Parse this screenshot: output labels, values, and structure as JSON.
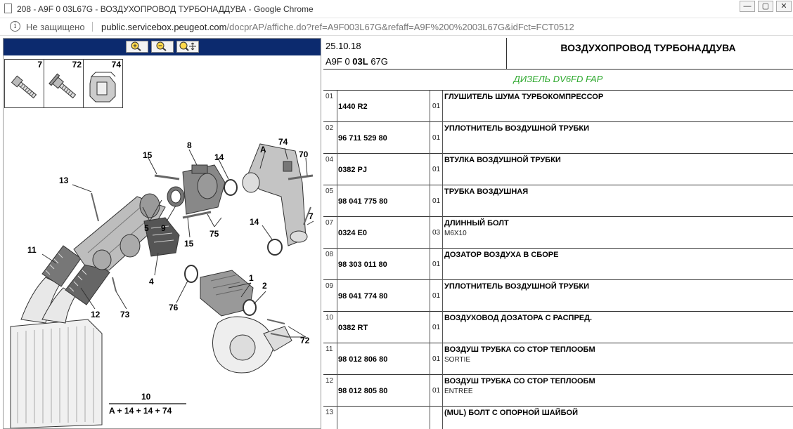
{
  "window": {
    "title": "208 - A9F 0 03L67G - ВОЗДУХОПРОВОД ТУРБОНАДДУВА - Google Chrome"
  },
  "address": {
    "security_text": "Не защищено",
    "domain": "public.servicebox.peugeot.com",
    "path": "/docprAP/affiche.do?ref=A9F003L67G&refaff=A9F%200%2003L67G&idFct=FCT0512"
  },
  "viewer": {
    "zoom_in_icon": "zoom-in-icon",
    "zoom_out_icon": "zoom-out-icon",
    "pan_icon": "zoom-move-icon"
  },
  "thumbnails": [
    {
      "num": "7",
      "icon": "bolt"
    },
    {
      "num": "72",
      "icon": "flange-bolt"
    },
    {
      "num": "74",
      "icon": "clip"
    }
  ],
  "diagram_labels": {
    "n8": "8",
    "n15a": "15",
    "n14a": "14",
    "nA": "A",
    "n74": "74",
    "n70": "70",
    "n13": "13",
    "n5": "5",
    "n9": "9",
    "n75": "75",
    "n15b": "15",
    "n14b": "14",
    "n7": "7",
    "n11": "11",
    "n4": "4",
    "n1": "1",
    "n2": "2",
    "n12": "12",
    "n73": "73",
    "n76": "76",
    "n72": "72",
    "n10": "10",
    "formula": "A + 14 + 14 + 74"
  },
  "header": {
    "date": "25.10.18",
    "ref_pre": "A9F 0 ",
    "ref_bold": "03L",
    "ref_post": " 67G",
    "title": "ВОЗДУХОПРОВОД ТУРБОНАДДУВА",
    "subtitle": "ДИЗЕЛЬ DV6FD FAP"
  },
  "colors": {
    "header_blue": "#0c2a6e",
    "subtitle_green": "#2da82d"
  },
  "parts": [
    {
      "idx": "01",
      "pn": "1440 R2",
      "qty": "01",
      "desc": "ГЛУШИТЕЛЬ ШУМА ТУРБОКОМПРЕССОР",
      "sub": ""
    },
    {
      "idx": "02",
      "pn": "96 711 529 80",
      "qty": "01",
      "desc": "УПЛОТНИТЕЛЬ ВОЗДУШНОЙ ТРУБКИ",
      "sub": ""
    },
    {
      "idx": "04",
      "pn": "0382 PJ",
      "qty": "01",
      "desc": "ВТУЛКА ВОЗДУШНОЙ ТРУБКИ",
      "sub": ""
    },
    {
      "idx": "05",
      "pn": "98 041 775 80",
      "qty": "01",
      "desc": "ТРУБКА ВОЗДУШНАЯ",
      "sub": ""
    },
    {
      "idx": "07",
      "pn": "0324 E0",
      "qty": "03",
      "desc": "ДЛИННЫЙ БОЛТ",
      "sub": "M6X10"
    },
    {
      "idx": "08",
      "pn": "98 303 011 80",
      "qty": "01",
      "desc": "ДОЗАТОР ВОЗДУХА В СБОРЕ",
      "sub": ""
    },
    {
      "idx": "09",
      "pn": "98 041 774 80",
      "qty": "01",
      "desc": "УПЛОТНИТЕЛЬ ВОЗДУШНОЙ ТРУБКИ",
      "sub": ""
    },
    {
      "idx": "10",
      "pn": "0382 RT",
      "qty": "01",
      "desc": "ВОЗДУХОВОД ДОЗАТОРА С РАСПРЕД.",
      "sub": ""
    },
    {
      "idx": "11",
      "pn": "98 012 806 80",
      "qty": "01",
      "desc": "ВОЗДУШ ТРУБКА СО СТОР ТЕПЛООБМ",
      "sub": "SORTIE"
    },
    {
      "idx": "12",
      "pn": "98 012 805 80",
      "qty": "01",
      "desc": "ВОЗДУШ ТРУБКА СО СТОР ТЕПЛООБМ",
      "sub": "ENTREE"
    },
    {
      "idx": "13",
      "pn": "",
      "qty": "",
      "desc": "(MUL) БОЛТ С ОПОРНОЙ ШАЙБОЙ",
      "sub": ""
    }
  ]
}
